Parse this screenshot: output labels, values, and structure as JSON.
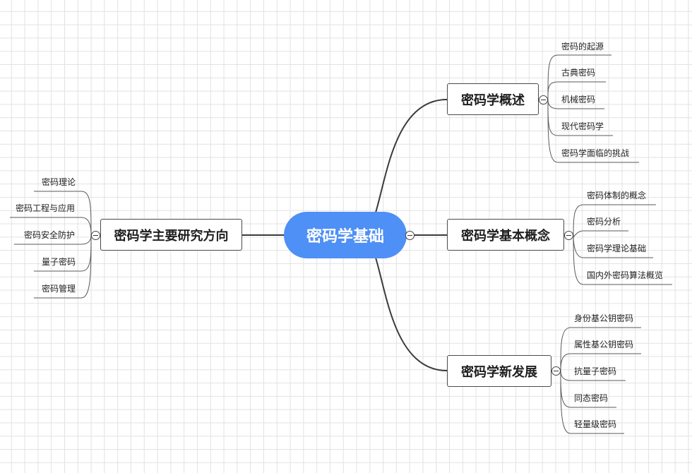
{
  "colors": {
    "root_fill": "#4e90f5",
    "line": "#3a3a3a",
    "grid": "#e2e2e2"
  },
  "root": {
    "label": "密码学基础"
  },
  "branches": [
    {
      "label": "密码学概述",
      "children": [
        "密码的起源",
        "古典密码",
        "机械密码",
        "现代密码学",
        "密码学面临的挑战"
      ]
    },
    {
      "label": "密码学基本概念",
      "children": [
        "密码体制的概念",
        "密码分析",
        "密码学理论基础",
        "国内外密码算法概览"
      ]
    },
    {
      "label": "密码学新发展",
      "children": [
        "身份基公钥密码",
        "属性基公钥密码",
        "抗量子密码",
        "同态密码",
        "轻量级密码"
      ]
    },
    {
      "label": "密码学主要研究方向",
      "children": [
        "密码理论",
        "密码工程与应用",
        "密码安全防护",
        "量子密码",
        "密码管理"
      ]
    }
  ],
  "icons": {
    "collapse": "collapse-minus-icon"
  }
}
